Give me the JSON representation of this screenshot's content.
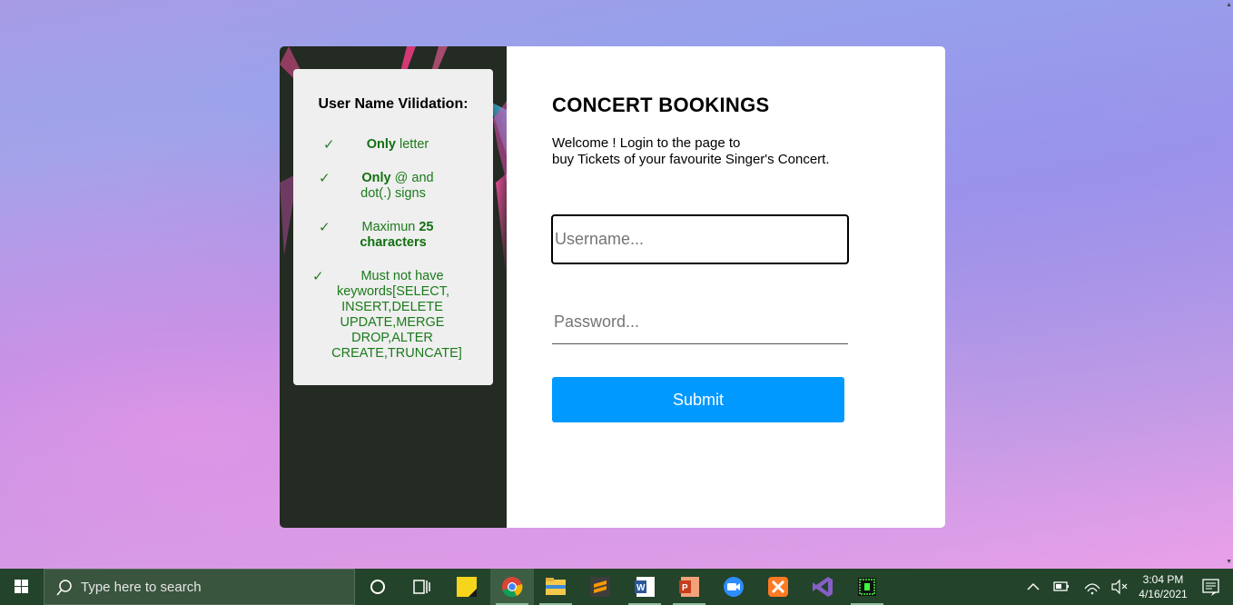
{
  "rules": {
    "title": "User Name Vilidation:",
    "items": [
      {
        "check": "✓",
        "bold": "Only",
        "text": " letter"
      },
      {
        "check": "✓",
        "bold": "Only",
        "text": " @ and",
        "line2": "dot(.) signs"
      },
      {
        "check": "✓",
        "text": "Maximun ",
        "bold": "25",
        "line2_bold": "characters"
      },
      {
        "check": "✓",
        "text": "Must not have",
        "line2": "keywords[SELECT,",
        "line3": "INSERT,DELETE",
        "line4": "UPDATE,MERGE",
        "line5": "DROP,ALTER",
        "line6": "CREATE,TRUNCATE]"
      }
    ]
  },
  "form": {
    "title": "CONCERT BOOKINGS",
    "welcome_line1": "Welcome ! Login to the page to",
    "welcome_line2": "buy Tickets of your favourite Singer's Concert.",
    "username_placeholder": "Username...",
    "password_placeholder": "Password...",
    "submit_label": "Submit"
  },
  "taskbar": {
    "search_placeholder": "Type here to search",
    "time": "3:04 PM",
    "date": "4/16/2021",
    "apps": [
      "cortana-icon",
      "task-view-icon",
      "sticky-notes-icon",
      "chrome-icon",
      "file-explorer-icon",
      "sublime-text-icon",
      "word-icon",
      "powerpoint-icon",
      "zoom-icon",
      "xampp-icon",
      "visual-studio-icon",
      "terminal-app-icon"
    ]
  },
  "colors": {
    "rule_text": "#1b7a1b",
    "submit_bg": "#0099ff",
    "card_left_bg": "#232b22",
    "taskbar_bg": "#23432a"
  }
}
